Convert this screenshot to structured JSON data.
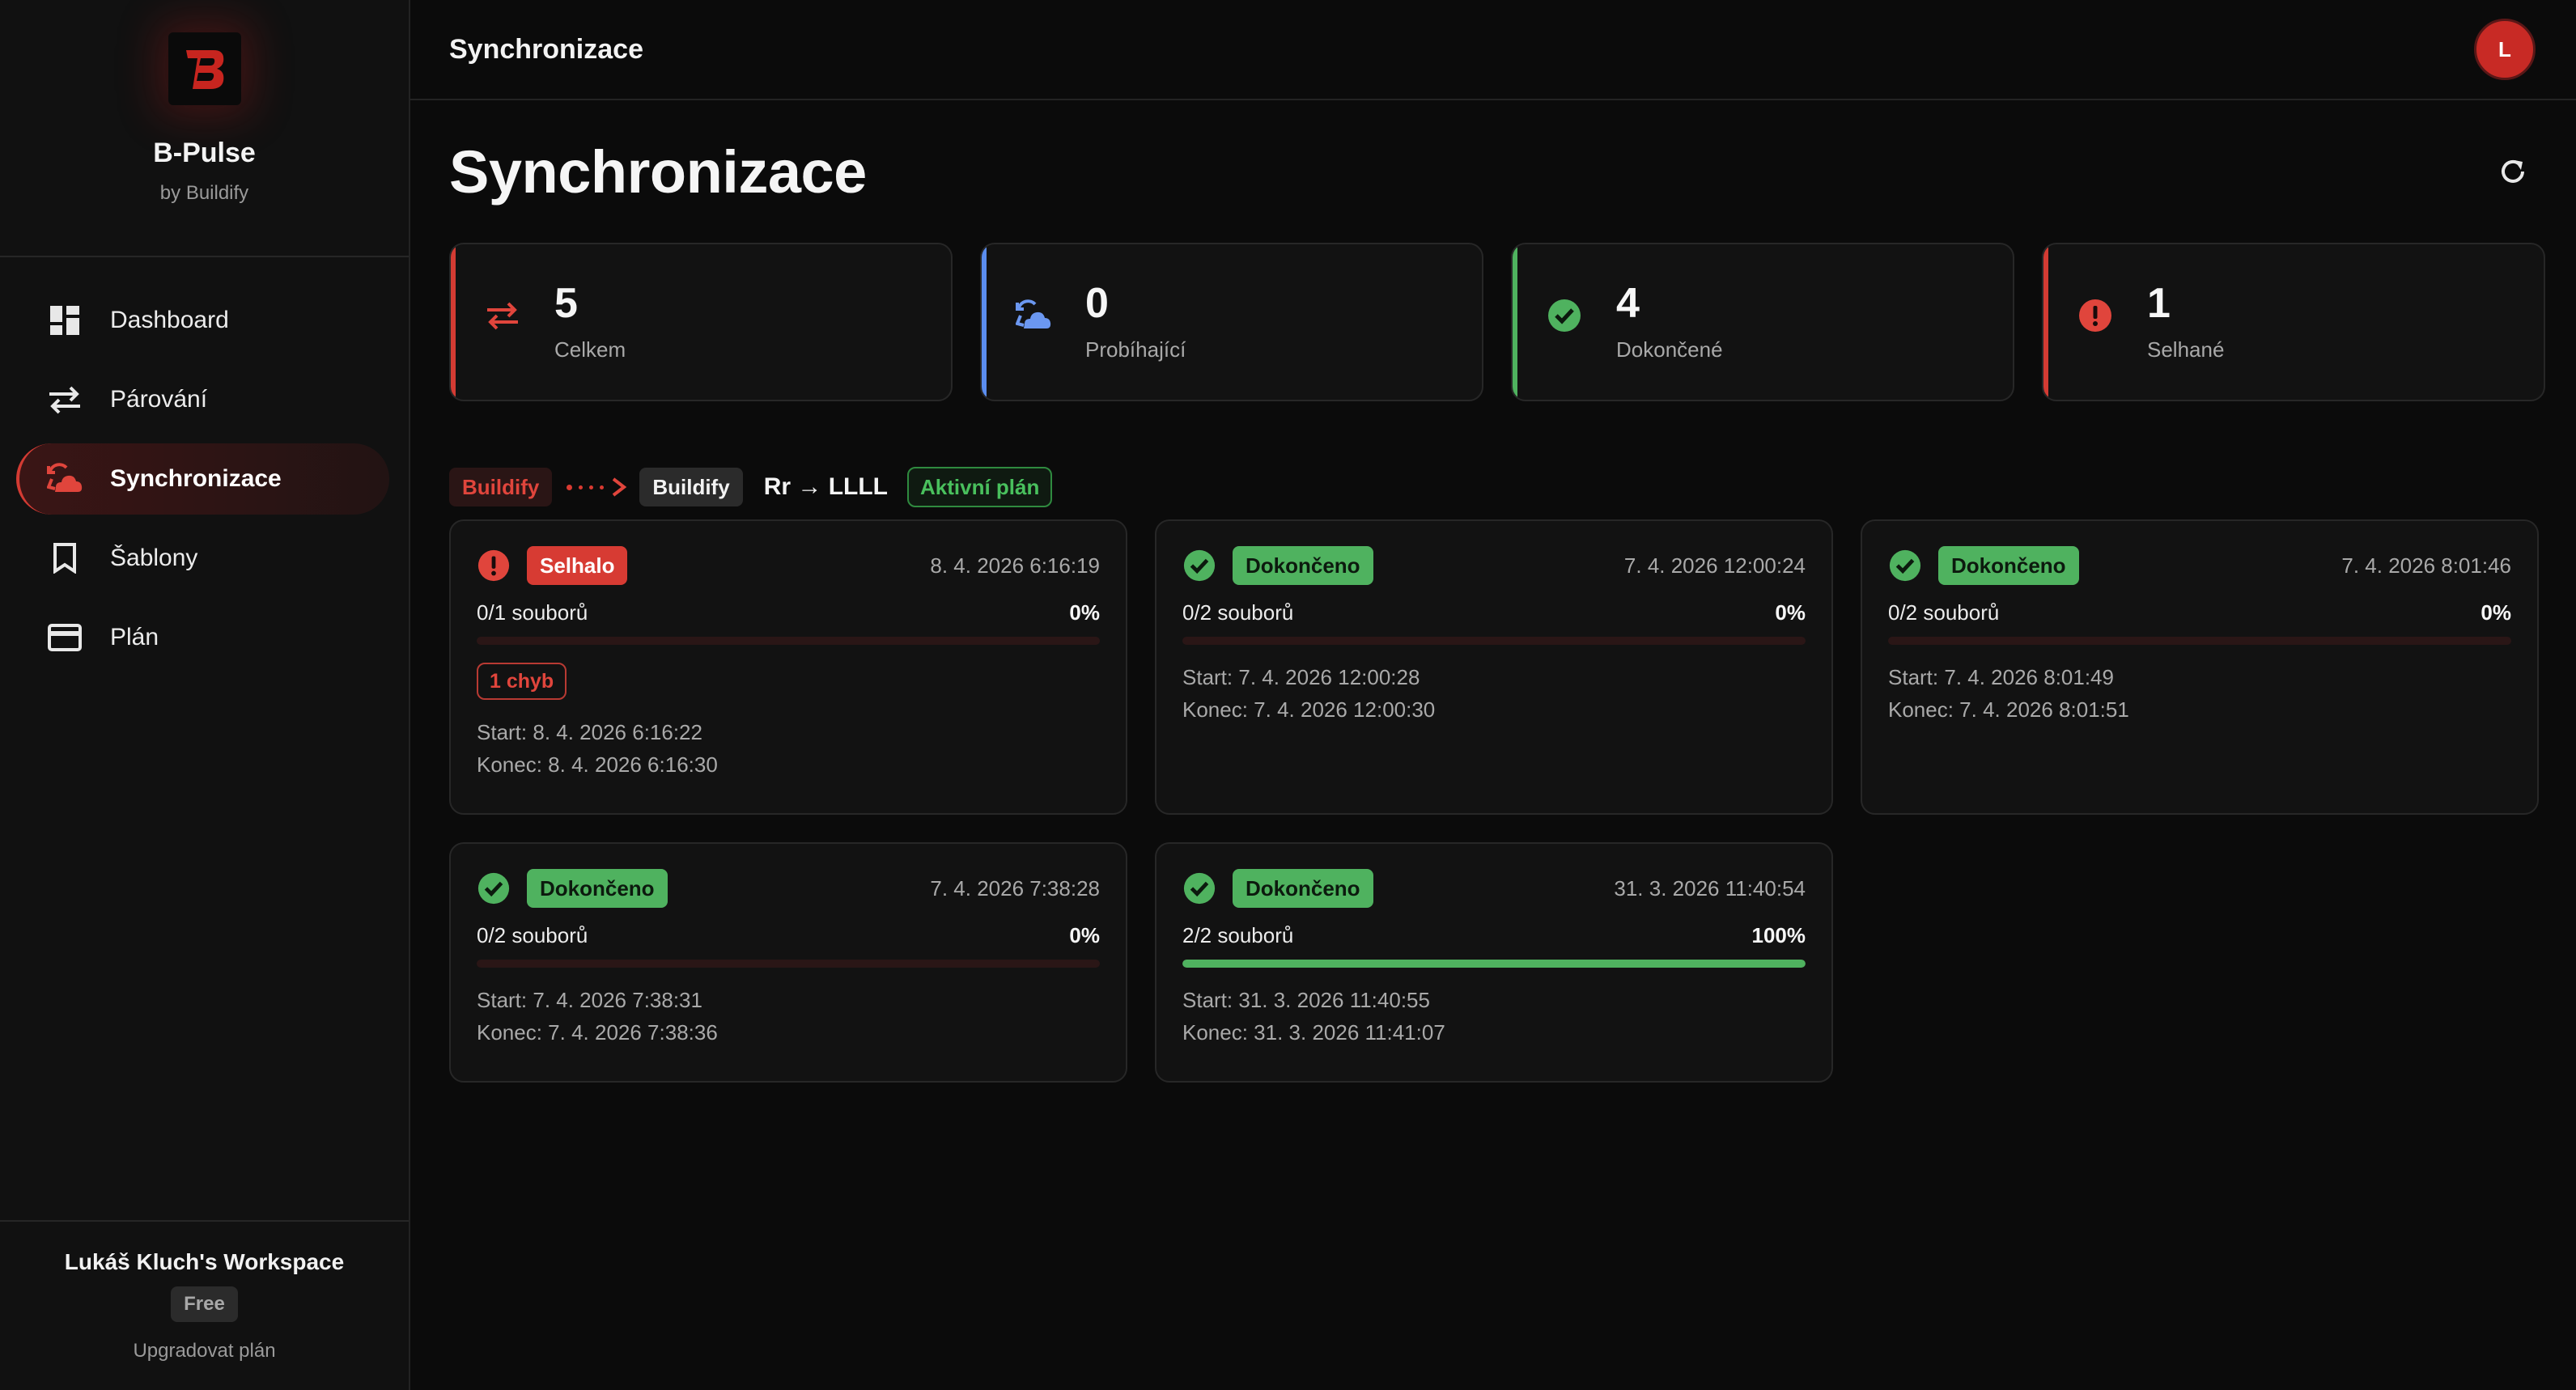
{
  "brand": {
    "name": "B-Pulse",
    "sub": "by Buildify",
    "logo_icon": "b-logo-icon",
    "accent": "#d33b33"
  },
  "nav": [
    {
      "label": "Dashboard",
      "icon": "dashboard-icon",
      "active": false
    },
    {
      "label": "Párování",
      "icon": "arrows-swap-icon",
      "active": false
    },
    {
      "label": "Synchronizace",
      "icon": "sync-cloud-icon",
      "active": true
    },
    {
      "label": "Šablony",
      "icon": "bookmark-icon",
      "active": false
    },
    {
      "label": "Plán",
      "icon": "credit-card-icon",
      "active": false
    }
  ],
  "workspace": {
    "name": "Lukáš Kluch's Workspace",
    "badge": "Free",
    "upgrade": "Upgradovat plán"
  },
  "topbar": {
    "title": "Synchronizace",
    "avatar_initial": "L"
  },
  "page": {
    "title": "Synchronizace",
    "refresh_icon": "refresh-icon"
  },
  "stats": [
    {
      "value": "5",
      "label": "Celkem",
      "icon": "arrows-swap-icon",
      "accent": "#d33b33"
    },
    {
      "value": "0",
      "label": "Probíhající",
      "icon": "sync-cloud-icon",
      "accent": "#5b8def"
    },
    {
      "value": "4",
      "label": "Dokončené",
      "icon": "check-circle-icon",
      "accent": "#4fb25f"
    },
    {
      "value": "1",
      "label": "Selhané",
      "icon": "error-circle-icon",
      "accent": "#d33b33"
    }
  ],
  "plan": {
    "source": "Buildify",
    "target": "Buildify",
    "name": "Rr → LLLL",
    "status": "Aktivní plán"
  },
  "syncs": [
    {
      "status": "failed",
      "badge": "Selhalo",
      "date": "8. 4. 2026 6:16:19",
      "files": "0/1 souborů",
      "percent": "0%",
      "progress": 0,
      "errors": "1 chyb",
      "start": "Start: 8. 4. 2026 6:16:22",
      "end": "Konec: 8. 4. 2026 6:16:30"
    },
    {
      "status": "done",
      "badge": "Dokončeno",
      "date": "7. 4. 2026 12:00:24",
      "files": "0/2 souborů",
      "percent": "0%",
      "progress": 0,
      "errors": "",
      "start": "Start: 7. 4. 2026 12:00:28",
      "end": "Konec: 7. 4. 2026 12:00:30"
    },
    {
      "status": "done",
      "badge": "Dokončeno",
      "date": "7. 4. 2026 8:01:46",
      "files": "0/2 souborů",
      "percent": "0%",
      "progress": 0,
      "errors": "",
      "start": "Start: 7. 4. 2026 8:01:49",
      "end": "Konec: 7. 4. 2026 8:01:51"
    },
    {
      "status": "done",
      "badge": "Dokončeno",
      "date": "7. 4. 2026 7:38:28",
      "files": "0/2 souborů",
      "percent": "0%",
      "progress": 0,
      "errors": "",
      "start": "Start: 7. 4. 2026 7:38:31",
      "end": "Konec: 7. 4. 2026 7:38:36"
    },
    {
      "status": "done",
      "badge": "Dokončeno",
      "date": "31. 3. 2026 11:40:54",
      "files": "2/2 souborů",
      "percent": "100%",
      "progress": 1,
      "errors": "",
      "start": "Start: 31. 3. 2026 11:40:55",
      "end": "Konec: 31. 3. 2026 11:41:07"
    }
  ]
}
